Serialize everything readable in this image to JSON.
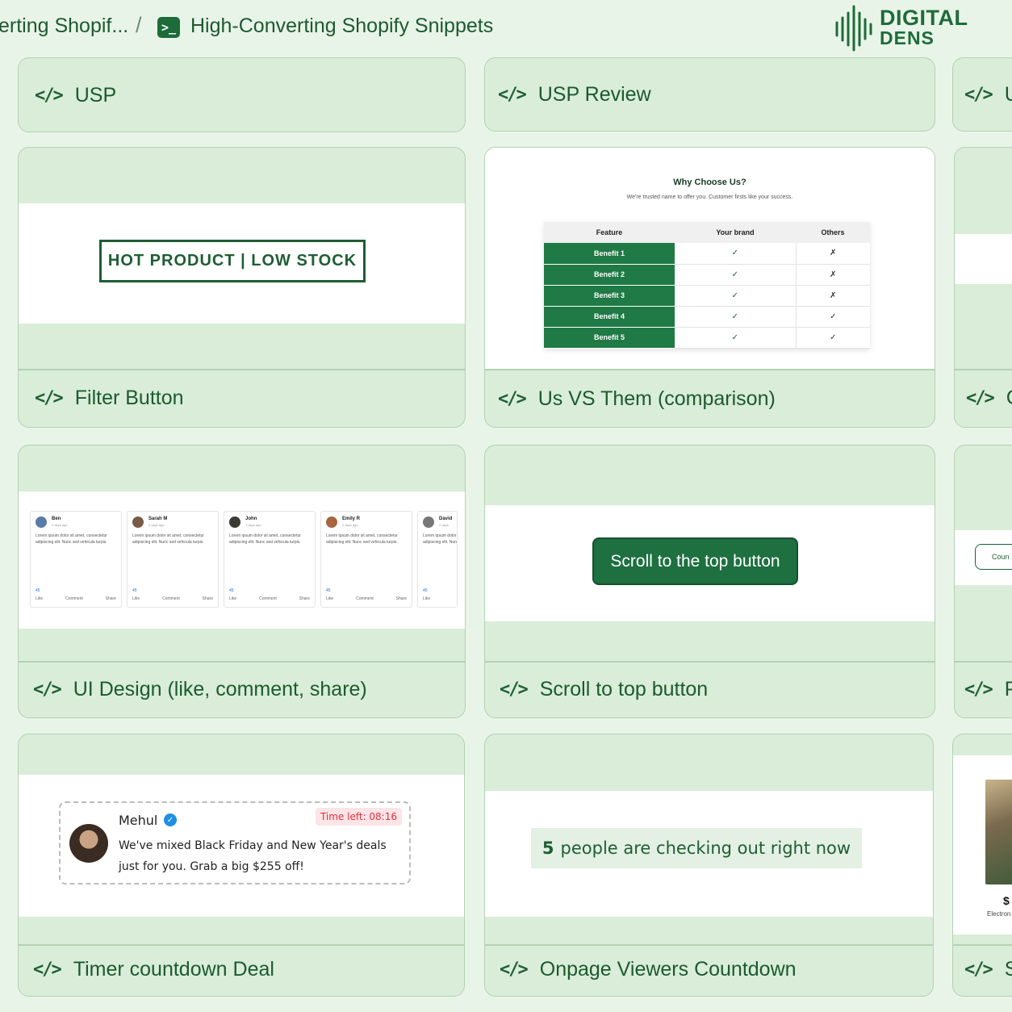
{
  "header": {
    "breadcrumb_prev": "erting Shopif...",
    "separator": "/",
    "breadcrumb_current": "High-Converting Shopify Snippets",
    "logo_line1": "DIGITAL",
    "logo_line2": "DENS"
  },
  "code_symbol": "</>",
  "cards": {
    "usp": {
      "title": "USP"
    },
    "usp_review": {
      "title": "USP Review"
    },
    "right_1": {
      "title": "U"
    },
    "filter": {
      "title": "Filter Button",
      "preview_label": "HOT PRODUCT | LOW STOCK"
    },
    "comparison": {
      "title": "Us VS Them (comparison)",
      "heading": "Why Choose Us?",
      "subheading": "We're trusted name to offer you. Customer firsts like your success.",
      "columns": [
        "Feature",
        "Your brand",
        "Others"
      ],
      "rows": [
        {
          "feature": "Benefit 1",
          "brand": "✓",
          "others": "✗"
        },
        {
          "feature": "Benefit 2",
          "brand": "✓",
          "others": "✗"
        },
        {
          "feature": "Benefit 3",
          "brand": "✓",
          "others": "✗"
        },
        {
          "feature": "Benefit 4",
          "brand": "✓",
          "others": "✓"
        },
        {
          "feature": "Benefit 5",
          "brand": "✓",
          "others": "✓"
        }
      ]
    },
    "right_2": {
      "title": "C"
    },
    "ui_design": {
      "title": "UI Design (like, comment, share)",
      "posts": [
        {
          "name": "Ben",
          "time": "2 days ago"
        },
        {
          "name": "Sarah M",
          "time": "2 days ago"
        },
        {
          "name": "John",
          "time": "1 days ago"
        },
        {
          "name": "Emily R",
          "time": "2 days ago"
        },
        {
          "name": "David",
          "time": "2 days"
        }
      ],
      "post_body": "Lorem ipsum dolor sit amet, consectetur adipiscing elit. Nunc sed vehicula turpis.",
      "post_count": "45",
      "action_like": "Like",
      "action_comment": "Comment",
      "action_share": "Share"
    },
    "scroll_top": {
      "title": "Scroll to top button",
      "button_label": "Scroll to the top button"
    },
    "right_3": {
      "title": "P",
      "preview_button": "Coun"
    },
    "timer": {
      "title": "Timer countdown Deal",
      "name": "Mehul",
      "badge": "Time left: 08:16",
      "message": "We've mixed Black Friday and New Year's deals just for you. Grab a big $255 off!"
    },
    "viewers": {
      "title": "Onpage Viewers Countdown",
      "count": "5",
      "text": "people are checking out right now"
    },
    "right_4": {
      "title": "S",
      "price": "$",
      "category": "Electron"
    }
  }
}
